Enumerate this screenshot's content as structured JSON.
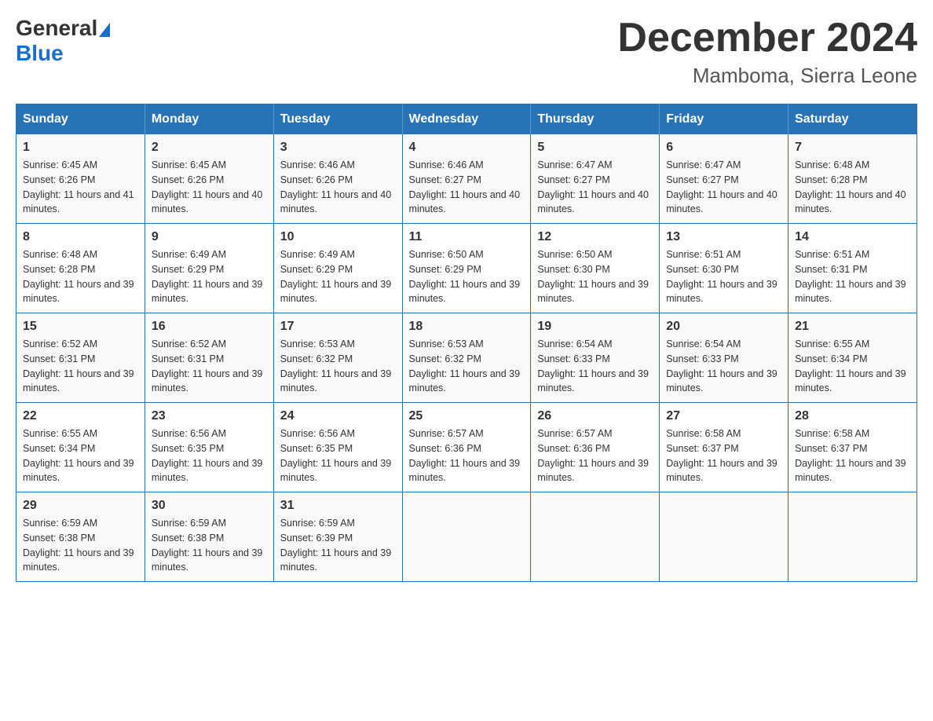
{
  "header": {
    "logo": {
      "general": "General",
      "blue": "Blue"
    },
    "title": "December 2024",
    "subtitle": "Mamboma, Sierra Leone"
  },
  "days_of_week": [
    "Sunday",
    "Monday",
    "Tuesday",
    "Wednesday",
    "Thursday",
    "Friday",
    "Saturday"
  ],
  "weeks": [
    [
      {
        "day": "1",
        "sunrise": "6:45 AM",
        "sunset": "6:26 PM",
        "daylight": "11 hours and 41 minutes."
      },
      {
        "day": "2",
        "sunrise": "6:45 AM",
        "sunset": "6:26 PM",
        "daylight": "11 hours and 40 minutes."
      },
      {
        "day": "3",
        "sunrise": "6:46 AM",
        "sunset": "6:26 PM",
        "daylight": "11 hours and 40 minutes."
      },
      {
        "day": "4",
        "sunrise": "6:46 AM",
        "sunset": "6:27 PM",
        "daylight": "11 hours and 40 minutes."
      },
      {
        "day": "5",
        "sunrise": "6:47 AM",
        "sunset": "6:27 PM",
        "daylight": "11 hours and 40 minutes."
      },
      {
        "day": "6",
        "sunrise": "6:47 AM",
        "sunset": "6:27 PM",
        "daylight": "11 hours and 40 minutes."
      },
      {
        "day": "7",
        "sunrise": "6:48 AM",
        "sunset": "6:28 PM",
        "daylight": "11 hours and 40 minutes."
      }
    ],
    [
      {
        "day": "8",
        "sunrise": "6:48 AM",
        "sunset": "6:28 PM",
        "daylight": "11 hours and 39 minutes."
      },
      {
        "day": "9",
        "sunrise": "6:49 AM",
        "sunset": "6:29 PM",
        "daylight": "11 hours and 39 minutes."
      },
      {
        "day": "10",
        "sunrise": "6:49 AM",
        "sunset": "6:29 PM",
        "daylight": "11 hours and 39 minutes."
      },
      {
        "day": "11",
        "sunrise": "6:50 AM",
        "sunset": "6:29 PM",
        "daylight": "11 hours and 39 minutes."
      },
      {
        "day": "12",
        "sunrise": "6:50 AM",
        "sunset": "6:30 PM",
        "daylight": "11 hours and 39 minutes."
      },
      {
        "day": "13",
        "sunrise": "6:51 AM",
        "sunset": "6:30 PM",
        "daylight": "11 hours and 39 minutes."
      },
      {
        "day": "14",
        "sunrise": "6:51 AM",
        "sunset": "6:31 PM",
        "daylight": "11 hours and 39 minutes."
      }
    ],
    [
      {
        "day": "15",
        "sunrise": "6:52 AM",
        "sunset": "6:31 PM",
        "daylight": "11 hours and 39 minutes."
      },
      {
        "day": "16",
        "sunrise": "6:52 AM",
        "sunset": "6:31 PM",
        "daylight": "11 hours and 39 minutes."
      },
      {
        "day": "17",
        "sunrise": "6:53 AM",
        "sunset": "6:32 PM",
        "daylight": "11 hours and 39 minutes."
      },
      {
        "day": "18",
        "sunrise": "6:53 AM",
        "sunset": "6:32 PM",
        "daylight": "11 hours and 39 minutes."
      },
      {
        "day": "19",
        "sunrise": "6:54 AM",
        "sunset": "6:33 PM",
        "daylight": "11 hours and 39 minutes."
      },
      {
        "day": "20",
        "sunrise": "6:54 AM",
        "sunset": "6:33 PM",
        "daylight": "11 hours and 39 minutes."
      },
      {
        "day": "21",
        "sunrise": "6:55 AM",
        "sunset": "6:34 PM",
        "daylight": "11 hours and 39 minutes."
      }
    ],
    [
      {
        "day": "22",
        "sunrise": "6:55 AM",
        "sunset": "6:34 PM",
        "daylight": "11 hours and 39 minutes."
      },
      {
        "day": "23",
        "sunrise": "6:56 AM",
        "sunset": "6:35 PM",
        "daylight": "11 hours and 39 minutes."
      },
      {
        "day": "24",
        "sunrise": "6:56 AM",
        "sunset": "6:35 PM",
        "daylight": "11 hours and 39 minutes."
      },
      {
        "day": "25",
        "sunrise": "6:57 AM",
        "sunset": "6:36 PM",
        "daylight": "11 hours and 39 minutes."
      },
      {
        "day": "26",
        "sunrise": "6:57 AM",
        "sunset": "6:36 PM",
        "daylight": "11 hours and 39 minutes."
      },
      {
        "day": "27",
        "sunrise": "6:58 AM",
        "sunset": "6:37 PM",
        "daylight": "11 hours and 39 minutes."
      },
      {
        "day": "28",
        "sunrise": "6:58 AM",
        "sunset": "6:37 PM",
        "daylight": "11 hours and 39 minutes."
      }
    ],
    [
      {
        "day": "29",
        "sunrise": "6:59 AM",
        "sunset": "6:38 PM",
        "daylight": "11 hours and 39 minutes."
      },
      {
        "day": "30",
        "sunrise": "6:59 AM",
        "sunset": "6:38 PM",
        "daylight": "11 hours and 39 minutes."
      },
      {
        "day": "31",
        "sunrise": "6:59 AM",
        "sunset": "6:39 PM",
        "daylight": "11 hours and 39 minutes."
      },
      null,
      null,
      null,
      null
    ]
  ],
  "labels": {
    "sunrise": "Sunrise:",
    "sunset": "Sunset:",
    "daylight": "Daylight:"
  }
}
